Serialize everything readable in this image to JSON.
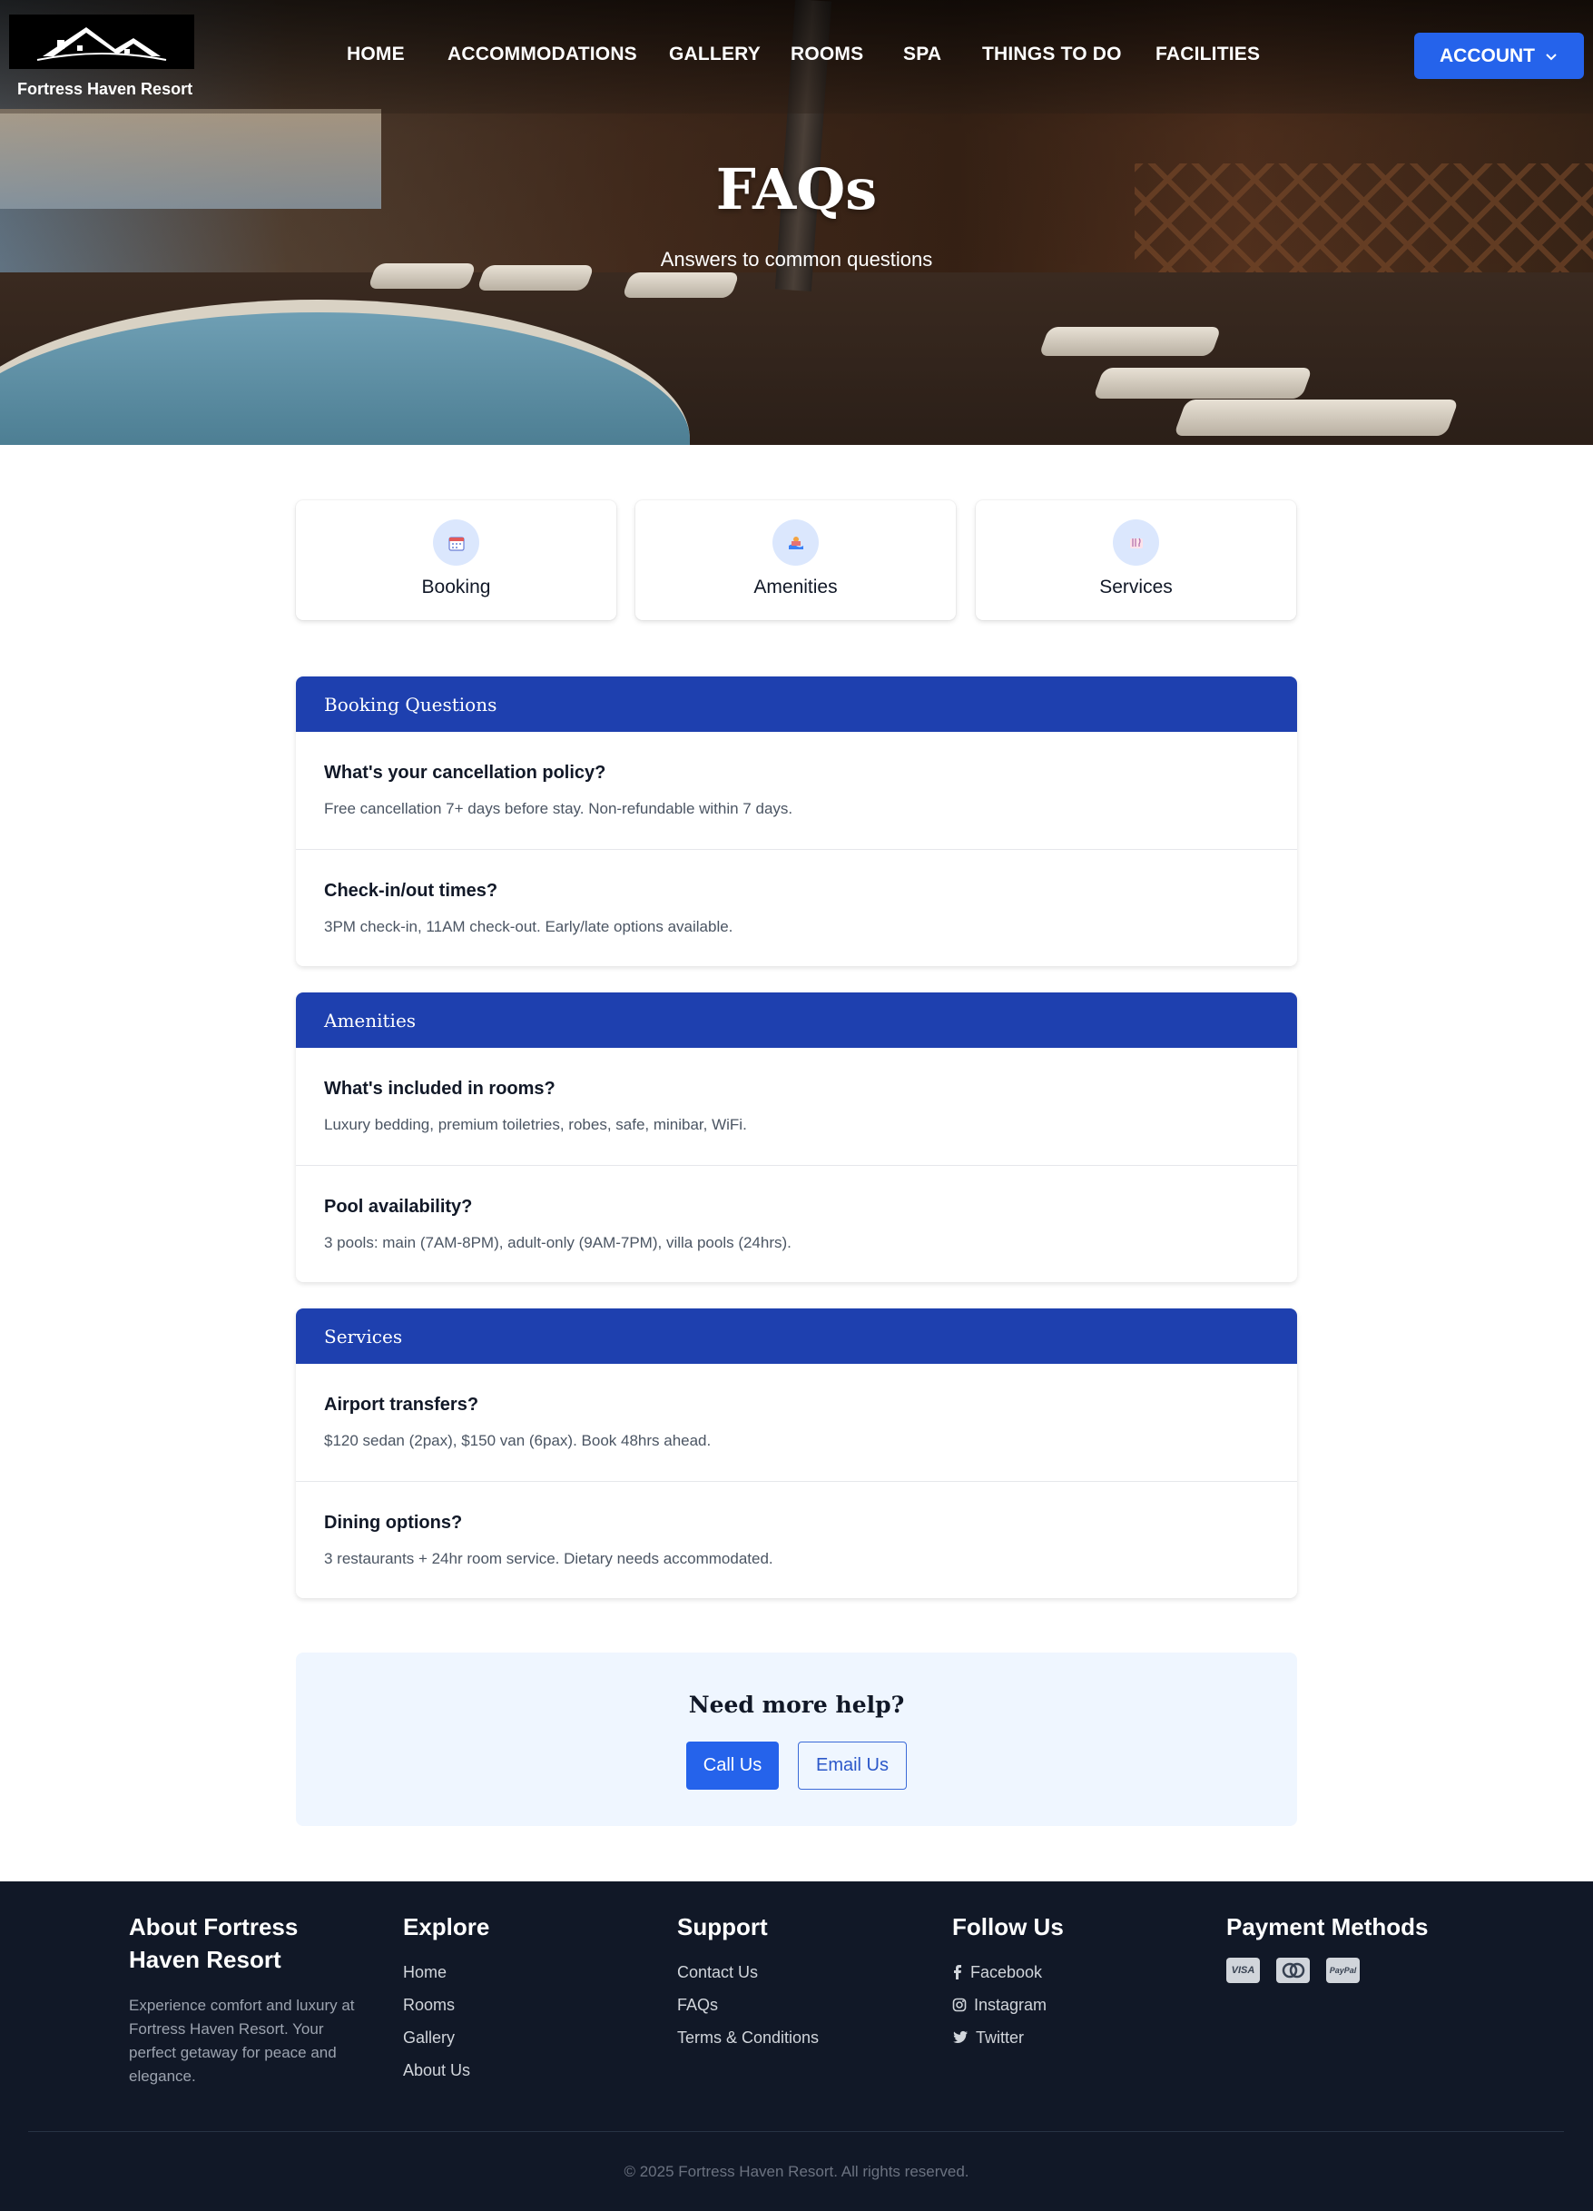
{
  "brand": {
    "name": "Fortress Haven Resort"
  },
  "nav": {
    "items": [
      "HOME",
      "ACCOMMODATIONS",
      "GALLERY",
      "ROOMS",
      "SPA",
      "THINGS TO DO",
      "FACILITIES"
    ]
  },
  "account": {
    "label": "ACCOUNT"
  },
  "hero": {
    "title": "FAQs",
    "subtitle": "Answers to common questions"
  },
  "categories": [
    {
      "label": "Booking",
      "icon": "calendar-icon"
    },
    {
      "label": "Amenities",
      "icon": "pool-icon"
    },
    {
      "label": "Services",
      "icon": "dining-icon"
    }
  ],
  "sections": [
    {
      "title": "Booking Questions",
      "items": [
        {
          "q": "What's your cancellation policy?",
          "a": "Free cancellation 7+ days before stay. Non-refundable within 7 days."
        },
        {
          "q": "Check-in/out times?",
          "a": "3PM check-in, 11AM check-out. Early/late options available."
        }
      ]
    },
    {
      "title": "Amenities",
      "items": [
        {
          "q": "What's included in rooms?",
          "a": "Luxury bedding, premium toiletries, robes, safe, minibar, WiFi."
        },
        {
          "q": "Pool availability?",
          "a": "3 pools: main (7AM-8PM), adult-only (9AM-7PM), villa pools (24hrs)."
        }
      ]
    },
    {
      "title": "Services",
      "items": [
        {
          "q": "Airport transfers?",
          "a": "$120 sedan (2pax), $150 van (6pax). Book 48hrs ahead."
        },
        {
          "q": "Dining options?",
          "a": "3 restaurants + 24hr room service. Dietary needs accommodated."
        }
      ]
    }
  ],
  "help": {
    "title": "Need more help?",
    "call": "Call Us",
    "email": "Email Us"
  },
  "footer": {
    "about": {
      "title": "About Fortress Haven Resort",
      "text": "Experience comfort and luxury at Fortress Haven Resort. Your perfect getaway for peace and elegance."
    },
    "explore": {
      "title": "Explore",
      "links": [
        "Home",
        "Rooms",
        "Gallery",
        "About Us"
      ]
    },
    "support": {
      "title": "Support",
      "links": [
        "Contact Us",
        "FAQs",
        "Terms & Conditions"
      ]
    },
    "follow": {
      "title": "Follow Us",
      "links": [
        "Facebook",
        "Instagram",
        "Twitter"
      ]
    },
    "payment": {
      "title": "Payment Methods",
      "methods": [
        "VISA",
        "MASTERCARD",
        "PayPal"
      ]
    },
    "copyright": "© 2025 Fortress Haven Resort. All rights reserved."
  },
  "colors": {
    "primary": "#2563eb",
    "section_header": "#1e40af",
    "footer_bg": "#111827",
    "help_bg": "#eff6ff"
  }
}
